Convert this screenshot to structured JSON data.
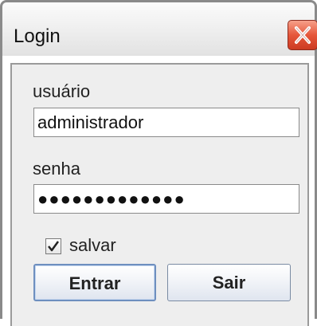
{
  "window": {
    "title": "Login"
  },
  "form": {
    "username_label": "usuário",
    "username_value": "administrador",
    "password_label": "senha",
    "password_value": "●●●●●●●●●●●●●",
    "remember_label": "salvar",
    "remember_checked": true
  },
  "buttons": {
    "enter_label": "Entrar",
    "exit_label": "Sair"
  },
  "icons": {
    "close": "close-icon",
    "checkmark": "checkmark-icon"
  },
  "colors": {
    "close_button": "#e6573b",
    "panel_background": "#eeeeee",
    "button_border": "#7a8ba3"
  }
}
